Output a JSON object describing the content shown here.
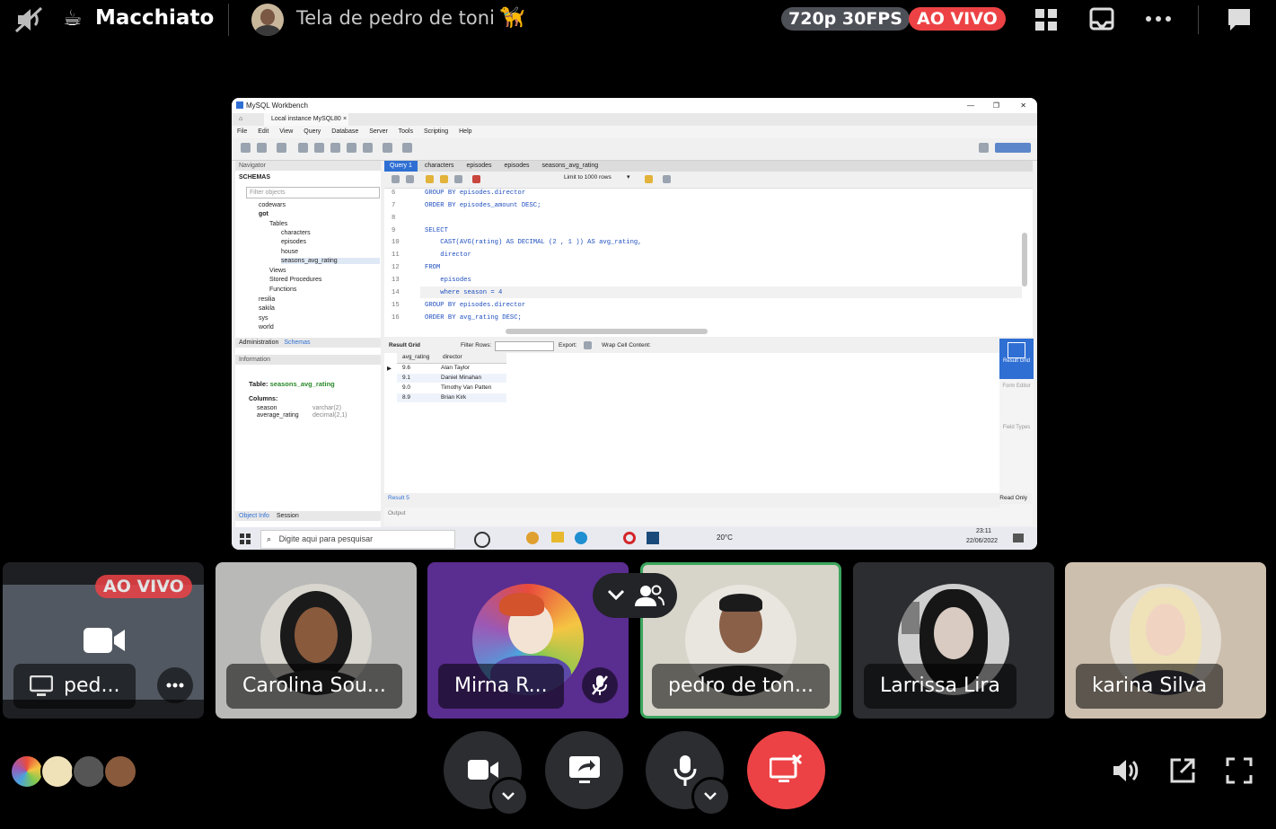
{
  "top_bar": {
    "channel_name": "Macchiato",
    "stream_title": "Tela de pedro de toni",
    "quality": "720p 30FPS",
    "live_badge": "AO VIVO"
  },
  "workbench": {
    "window_title": "MySQL Workbench",
    "connection_tab": "Local instance MySQL80",
    "menu": [
      "File",
      "Edit",
      "View",
      "Query",
      "Database",
      "Server",
      "Tools",
      "Scripting",
      "Help"
    ],
    "navigator_label": "Navigator",
    "schemas_label": "SCHEMAS",
    "filter_placeholder": "Filter objects",
    "schemas": [
      "codewars",
      "got",
      "Tables",
      "characters",
      "episodes",
      "house",
      "seasons_avg_rating",
      "Views",
      "Stored Procedures",
      "Functions",
      "resilia",
      "sakila",
      "sys",
      "world"
    ],
    "nav_tabs": [
      "Administration",
      "Schemas"
    ],
    "information_label": "Information",
    "query_tabs": [
      "Query 1",
      "characters",
      "episodes",
      "episodes",
      "seasons_avg_rating"
    ],
    "limit_label": "Limit to 1000 rows",
    "code": [
      {
        "n": "6",
        "t": "GROUP BY episodes.director"
      },
      {
        "n": "7",
        "t": "ORDER BY episodes_amount DESC;"
      },
      {
        "n": "8",
        "t": ""
      },
      {
        "n": "9",
        "t": "SELECT"
      },
      {
        "n": "10",
        "t": "    CAST(AVG(rating) AS DECIMAL (2 , 1 )) AS avg_rating,"
      },
      {
        "n": "11",
        "t": "    director"
      },
      {
        "n": "12",
        "t": "FROM"
      },
      {
        "n": "13",
        "t": "    episodes"
      },
      {
        "n": "14",
        "t": "    where season = 4"
      },
      {
        "n": "15",
        "t": "GROUP BY episodes.director"
      },
      {
        "n": "16",
        "t": "ORDER BY avg_rating DESC;"
      }
    ],
    "result_bar": {
      "grid": "Result Grid",
      "filter": "Filter Rows:",
      "export": "Export:",
      "wrap": "Wrap Cell Content:"
    },
    "result_columns": [
      "avg_rating",
      "director"
    ],
    "result_rows": [
      [
        "9.6",
        "Alan Taylor"
      ],
      [
        "9.1",
        "Daniel Minahan"
      ],
      [
        "9.0",
        "Timothy Van Patten"
      ],
      [
        "8.9",
        "Brian Kirk"
      ]
    ],
    "side_buttons": [
      "Result Grid",
      "Form Editor",
      "Field Types"
    ],
    "table_info": {
      "label": "Table:",
      "name": "seasons_avg_rating",
      "columns_label": "Columns:",
      "cols": [
        [
          "season",
          "varchar(2)"
        ],
        [
          "average_rating",
          "decimal(2,1)"
        ]
      ]
    },
    "result_tab": "Result 5",
    "read_only": "Read Only",
    "output_label": "Output",
    "bottom_tabs": [
      "Object Info",
      "Session"
    ],
    "taskbar": {
      "search": "Digite aqui para pesquisar",
      "temp": "20°C",
      "time": "23:11",
      "date": "22/06/2022"
    }
  },
  "participants": [
    {
      "name": "ped...",
      "live": "AO VIVO"
    },
    {
      "name": "Carolina Sou..."
    },
    {
      "name": "Mirna R..."
    },
    {
      "name": "pedro de ton..."
    },
    {
      "name": "Larrissa Lira"
    },
    {
      "name": "karina Silva"
    }
  ]
}
